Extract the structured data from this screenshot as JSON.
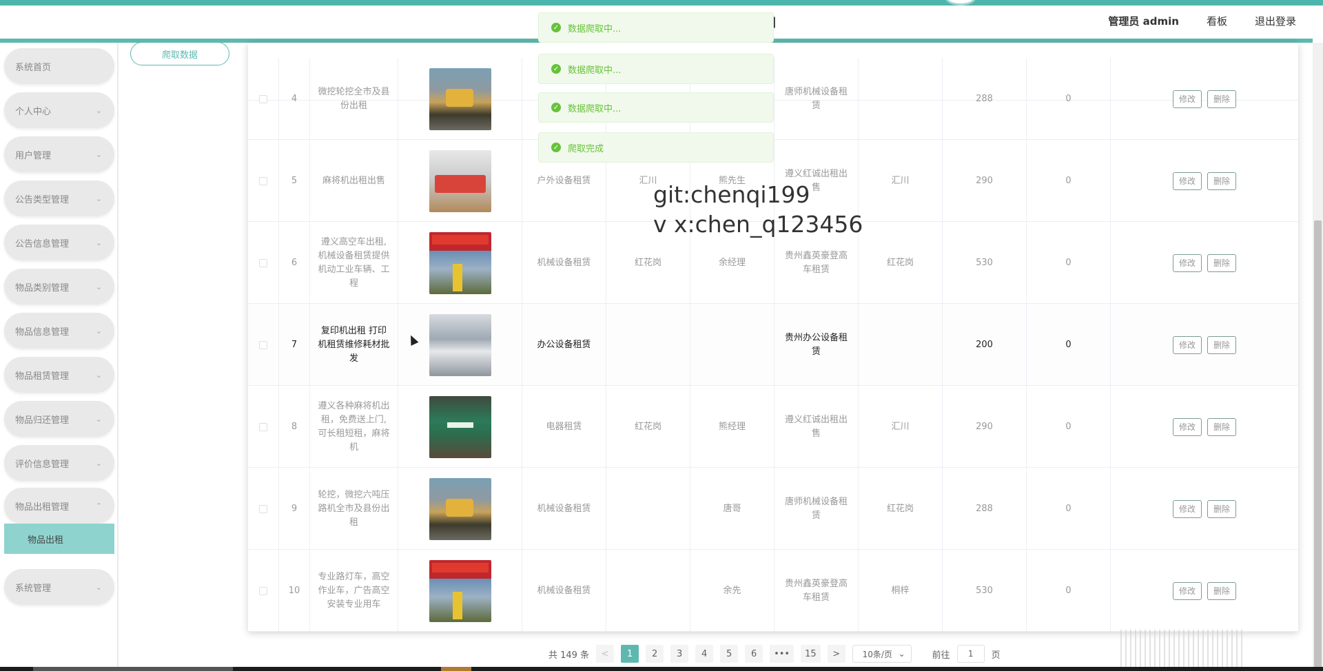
{
  "header": {
    "title_fragment": "]",
    "admin_label": "管理员 admin",
    "board_label": "看板",
    "logout_label": "退出登录"
  },
  "sidebar": {
    "items": [
      {
        "label": "系统首页",
        "chevron": ""
      },
      {
        "label": "个人中心",
        "chevron": "⌄"
      },
      {
        "label": "用户管理",
        "chevron": "⌄"
      },
      {
        "label": "公告类型管理",
        "chevron": "⌄"
      },
      {
        "label": "公告信息管理",
        "chevron": "⌄"
      },
      {
        "label": "物品类别管理",
        "chevron": "⌄"
      },
      {
        "label": "物品信息管理",
        "chevron": "⌄"
      },
      {
        "label": "物品租赁管理",
        "chevron": "⌄"
      },
      {
        "label": "物品归还管理",
        "chevron": "⌄"
      },
      {
        "label": "评价信息管理",
        "chevron": "⌄"
      },
      {
        "label": "物品出租管理",
        "chevron": "⌃"
      },
      {
        "label": "系统管理",
        "chevron": "⌄"
      }
    ],
    "sub_item": "物品出租"
  },
  "toolbar": {
    "crawl_label": "爬取数据"
  },
  "toasts": [
    "数据爬取中...",
    "数据爬取中...",
    "数据爬取中...",
    "爬取完成"
  ],
  "watermark": {
    "line1": "git:chenqi199",
    "line2": "v x:chen_q123456"
  },
  "table": {
    "rows": [
      {
        "index": "4",
        "name": "微挖轮挖全市及县份出租",
        "image": "excavator",
        "category": "",
        "area": "",
        "contact": "",
        "shop": "唐师机械设备租赁",
        "region": "",
        "price": "288",
        "count": "0"
      },
      {
        "index": "5",
        "name": "麻将机出租出售",
        "image": "scaffold",
        "category": "户外设备租赁",
        "area": "汇川",
        "contact": "熊先生",
        "shop": "遵义红诚出租出售",
        "region": "汇川",
        "price": "290",
        "count": "0"
      },
      {
        "index": "6",
        "name": "遵义高空车出租,机械设备租赁提供机动工业车辆、工程",
        "image": "aerial",
        "category": "机械设备租赁",
        "area": "红花岗",
        "contact": "余经理",
        "shop": "贵州鑫英豪登高车租赁",
        "region": "红花岗",
        "price": "530",
        "count": "0"
      },
      {
        "index": "7",
        "name": "复印机出租 打印机租赁维修耗材批发",
        "image": "copier",
        "category": "办公设备租赁",
        "area": "",
        "contact": "",
        "shop": "贵州办公设备租赁",
        "region": "",
        "price": "200",
        "count": "0"
      },
      {
        "index": "8",
        "name": "遵义各种麻将机出租，免费送上门,可长租短租，麻将机",
        "image": "mahjong",
        "category": "电器租赁",
        "area": "红花岗",
        "contact": "熊经理",
        "shop": "遵义红诚出租出售",
        "region": "汇川",
        "price": "290",
        "count": "0"
      },
      {
        "index": "9",
        "name": "轮挖，微挖六吨压路机全市及县份出租",
        "image": "excavator",
        "category": "机械设备租赁",
        "area": "",
        "contact": "唐哥",
        "shop": "唐师机械设备租赁",
        "region": "红花岗",
        "price": "288",
        "count": "0"
      },
      {
        "index": "10",
        "name": "专业路灯车，高空作业车，广告高空安装专业用车",
        "image": "aerial",
        "category": "机械设备租赁",
        "area": "",
        "contact": "余先",
        "shop": "贵州鑫英豪登高车租赁",
        "region": "桐梓",
        "price": "530",
        "count": "0"
      }
    ],
    "edit_label": "修改",
    "delete_label": "删除"
  },
  "pagination": {
    "total_text": "共 149 条",
    "prev": "<",
    "pages": [
      "1",
      "2",
      "3",
      "4",
      "5",
      "6",
      "•••",
      "15"
    ],
    "next": ">",
    "page_size": "10条/页",
    "goto_label": "前往",
    "goto_value": "1",
    "page_suffix": "页"
  },
  "colors": {
    "accent": "#5fb8b0",
    "toast_bg": "#f0f9eb",
    "toast_text": "#67c23a",
    "sidebar_active": "#8fd3cf"
  }
}
